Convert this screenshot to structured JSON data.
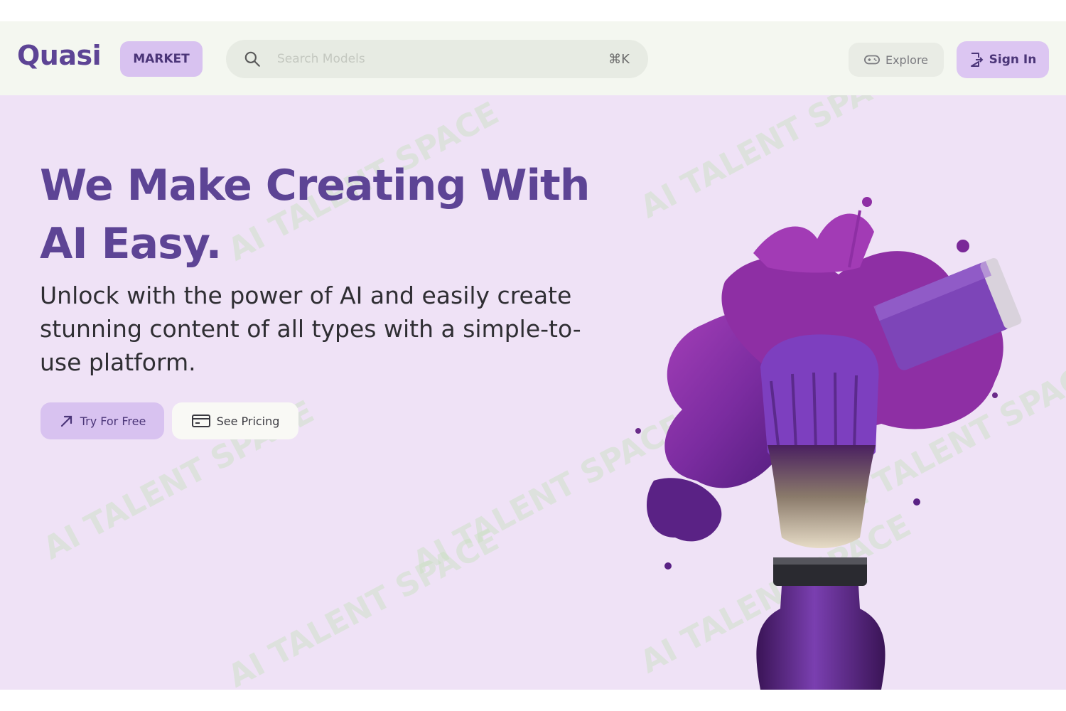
{
  "header": {
    "logo": "Quasi",
    "badge": "MARKET",
    "search": {
      "placeholder": "Search Models",
      "shortcut": "⌘K"
    },
    "explore_label": "Explore",
    "signin_label": "Sign In"
  },
  "hero": {
    "title": "We Make Creating With AI Easy.",
    "subtitle": "Unlock with the power of AI and easily create stunning content of all types with a simple-to-use platform.",
    "try_label": "Try For Free",
    "pricing_label": "See Pricing"
  },
  "watermark": "AI TALENT SPACE",
  "colors": {
    "brand": "#5d4495",
    "hero_background": "#efe2f6",
    "accent_button": "#d8c2f0",
    "header_background": "#f4f7f0"
  },
  "icons": {
    "search": "search-icon",
    "explore": "gamepad-icon",
    "signin": "sign-in-icon",
    "try": "arrow-up-right-icon",
    "pricing": "credit-card-icon"
  }
}
